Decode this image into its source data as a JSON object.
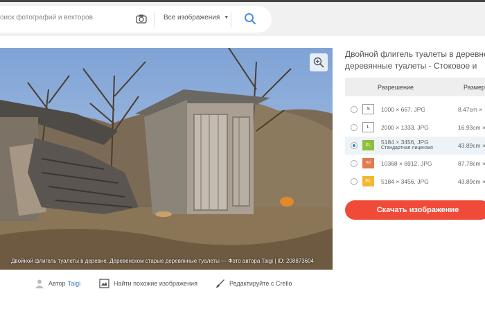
{
  "search": {
    "placeholder": "оиск фотографий и векторов",
    "dropdown_label": "Все изображения"
  },
  "photo": {
    "caption": "Двойной флигель туалеты в деревне. Деревенском старые деревянные туалеты — Фото автора Taigi | ID: 208873604"
  },
  "meta": {
    "author_label": "Автор",
    "author_name": "Taigi",
    "similar_label": "Найти похожие изображения",
    "edit_label": "Редактируйте с Crello"
  },
  "details": {
    "title_line1": "Двойной флигель туалеты в деревне",
    "title_line2": "деревянные туалеты  -   Стоковое и",
    "table_headers": [
      "Разрешение",
      "Размер"
    ],
    "rows": [
      {
        "badge": "S",
        "resolution": "1000 × 667, JPG",
        "license": "",
        "size": "8.47cm ×",
        "selected": false
      },
      {
        "badge": "L",
        "resolution": "2000 × 1333, JPG",
        "license": "",
        "size": "16.93cm ×",
        "selected": false
      },
      {
        "badge": "XL",
        "resolution": "5184 × 3456, JPG",
        "license": "Стандартная лицензия",
        "size": "43.89cm ×",
        "selected": true
      },
      {
        "badge": "HD",
        "resolution": "10368 × 6912, JPG",
        "license": "",
        "size": "87.78cm ×",
        "selected": false
      },
      {
        "badge": "EL",
        "resolution": "5184 × 3456, JPG",
        "license": "",
        "size": "43.89cm ×",
        "selected": false
      }
    ],
    "download_label": "Скачать изображение"
  },
  "colors": {
    "accent_red": "#f04a38",
    "link_blue": "#3b7bbf",
    "search_icon": "#4a90d9"
  }
}
